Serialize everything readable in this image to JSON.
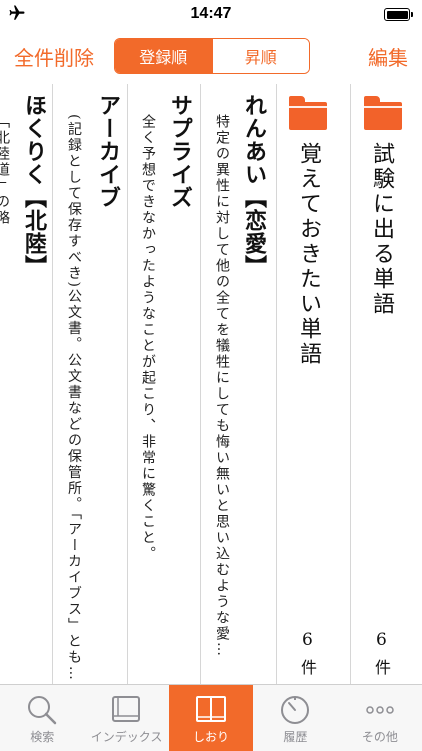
{
  "status_bar": {
    "time": "14:47"
  },
  "nav": {
    "left_button": "全件削除",
    "segments": [
      "登録順",
      "昇順"
    ],
    "selected_segment": "登録順",
    "right_button": "編集"
  },
  "folders": [
    {
      "title": "試験に出る単語",
      "count": "6",
      "unit": "件"
    },
    {
      "title": "覚えておきたい単語",
      "count": "6",
      "unit": "件"
    }
  ],
  "words": [
    {
      "head": "れんあい【恋愛】",
      "definition": "特定の異性に対して他の全てを犠牲にしても悔い無いと思い込むような愛…"
    },
    {
      "head": "サプライズ",
      "definition": "全く予想できなかったようなことが起こり、非常に驚くこと。"
    },
    {
      "head": "アーカイブ",
      "definition": "(記録として保存すべき)公文書。公文書などの保管所。「アーカイブス」とも…"
    },
    {
      "head": "ほくりく【北陸】",
      "definition": "「北陸道」の略"
    }
  ],
  "tabs": [
    {
      "label": "検索",
      "icon": "search-icon",
      "active": false
    },
    {
      "label": "インデックス",
      "icon": "book-icon",
      "active": false
    },
    {
      "label": "しおり",
      "icon": "open-book-icon",
      "active": true
    },
    {
      "label": "履歴",
      "icon": "history-icon",
      "active": false
    },
    {
      "label": "その他",
      "icon": "more-icon",
      "active": false
    }
  ],
  "colors": {
    "accent": "#f26a2a",
    "tab_inactive": "#8e8e93"
  }
}
